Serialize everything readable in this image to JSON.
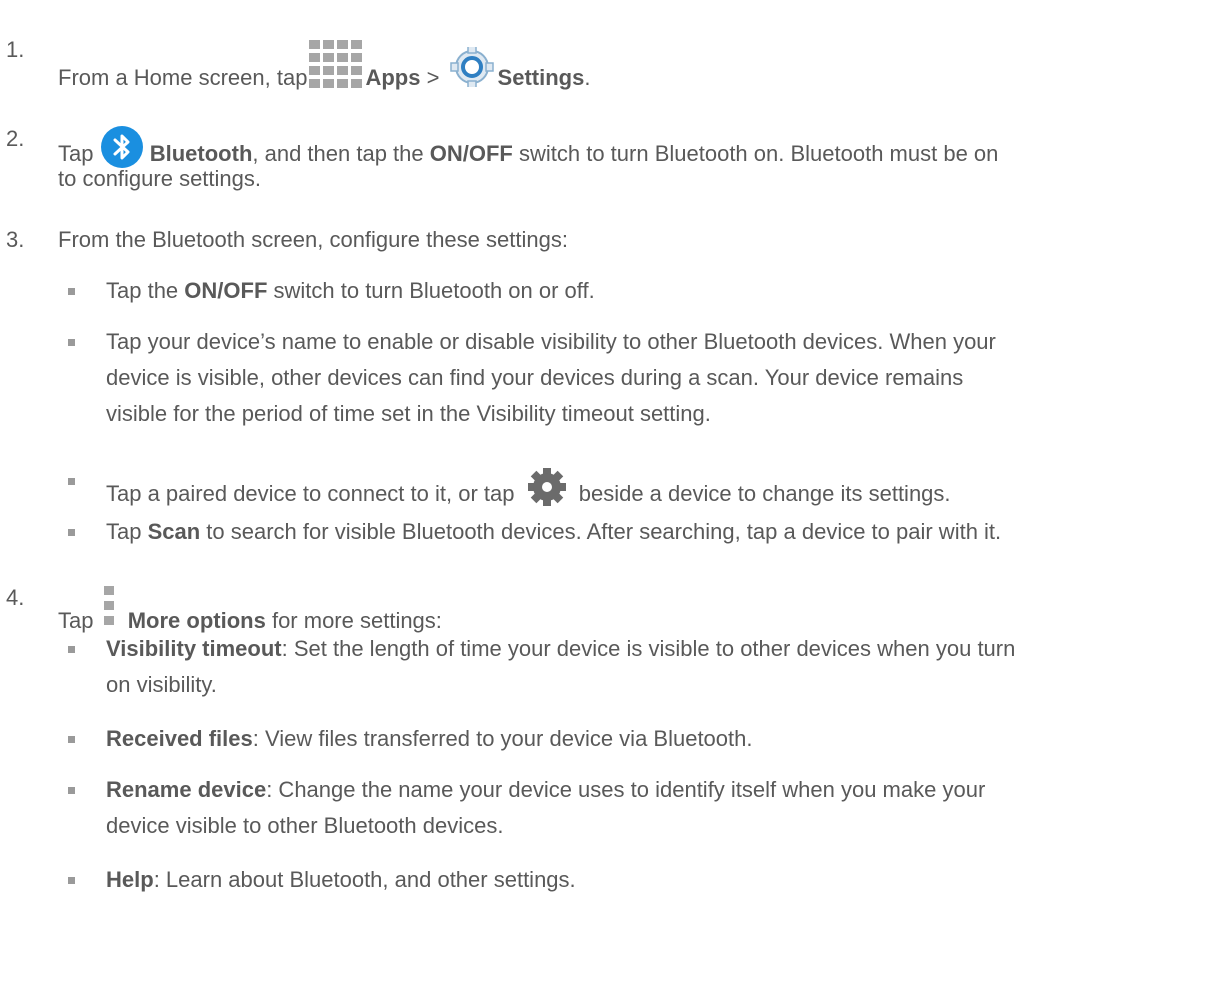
{
  "steps": [
    {
      "number": "1.",
      "pre": "From a Home screen, tap",
      "apps": "Apps",
      "gt": ">",
      "settings": "Settings",
      "end": "."
    },
    {
      "number": "2.",
      "pre": "Tap",
      "bluetooth": "Bluetooth",
      "mid1": ", and then tap the ",
      "onoff": "ON/OFF",
      "mid2": " switch to turn Bluetooth on. Bluetooth must be on",
      "line2": "to configure settings."
    },
    {
      "number": "3.",
      "text": "From the Bluetooth screen, configure these settings:"
    },
    {
      "number": "4.",
      "pre": "Tap",
      "more": "More options",
      "post": " for more settings:"
    }
  ],
  "step3_bullets": {
    "b1": {
      "pre": "Tap the ",
      "bold": "ON/OFF",
      "post": " switch to turn Bluetooth on or off."
    },
    "b2": {
      "l1": "Tap your device’s name to enable or disable visibility to other Bluetooth devices. When your",
      "l2": "device is visible, other devices can find your devices during a scan. Your device remains",
      "l3": "visible for the period of time set in the Visibility timeout setting."
    },
    "b3": {
      "pre": "Tap a paired device to connect to it, or tap",
      "post": "beside a device to change its settings."
    },
    "b4": {
      "pre": "Tap ",
      "bold": "Scan",
      "post": " to search for visible Bluetooth devices. After searching, tap a device to pair with it."
    }
  },
  "step4_bullets": {
    "b1": {
      "bold": "Visibility timeout",
      "post": ": Set the length of time your device is visible to other devices when you turn",
      "l2": "on visibility."
    },
    "b2": {
      "bold": "Received files",
      "post": ": View files transferred to your device via Bluetooth."
    },
    "b3": {
      "bold": "Rename device",
      "post": ": Change the name your device uses to identify itself when you make your",
      "l2": "device visible to other Bluetooth devices."
    },
    "b4": {
      "bold": "Help",
      "post": ": Learn about Bluetooth, and other settings."
    }
  },
  "icons": {
    "apps": "apps-grid-icon",
    "settings": "settings-gear-icon",
    "bluetooth": "bluetooth-icon",
    "gear": "gear-icon",
    "more": "more-options-icon"
  },
  "colors": {
    "text": "#595959",
    "bluetooth": "#1a8fe0",
    "bullet": "#9a9a9a"
  }
}
